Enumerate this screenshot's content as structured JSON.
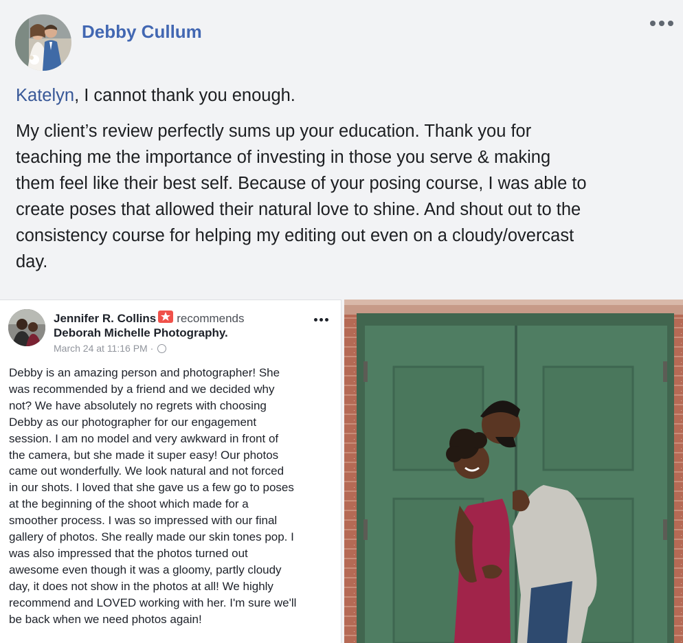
{
  "post": {
    "author": "Debby Cullum",
    "mention": "Katelyn",
    "first_line_rest": ", I cannot thank you enough.",
    "body_lines": [
      "My client’s review perfectly sums up your education. Thank you for",
      "teaching me the importance of investing in those you serve & making",
      "them feel like their best self. Because of your posing course, I was able to",
      "create poses that allowed their natural love to shine. And shout out to the",
      "consistency course for helping my editing out even on a cloudy/overcast",
      "day."
    ],
    "more_icon": "more-horizontal-icon"
  },
  "review": {
    "reviewer": "Jennifer R. Collins",
    "recommends": "recommends",
    "page": "Deborah Michelle Photography.",
    "date": "March 24 at 11:16 PM ·",
    "icons": [
      "recommend-star-icon",
      "globe-icon",
      "more-horizontal-icon"
    ],
    "text_lines": [
      "Debby is an amazing person and photographer! She",
      "was recommended by a friend and we decided why",
      "not? We have absolutely no regrets with choosing",
      "Debby as our photographer for our engagement",
      "session. I am no model and very awkward in front of",
      "the camera, but she made it super easy! Our photos",
      "came out wonderfully. We look natural and not forced",
      "in our shots. I loved that she gave us a few go to poses",
      "at the beginning of the shoot which made for a",
      "smoother process. I was so impressed with our final",
      "gallery of photos. She really made our skin tones pop. I",
      "was also impressed that the photos turned out",
      "awesome even though it was a gloomy, partly cloudy",
      "day, it does not show in the photos at all! We highly",
      "recommend and LOVED working with her. I'm sure we'll",
      "be back when we need photos again!"
    ]
  },
  "colors": {
    "link": "#4267b2",
    "mention": "#385898",
    "background": "#f2f3f5",
    "door_green": "#4f7d62",
    "brick": "#b56a55"
  }
}
